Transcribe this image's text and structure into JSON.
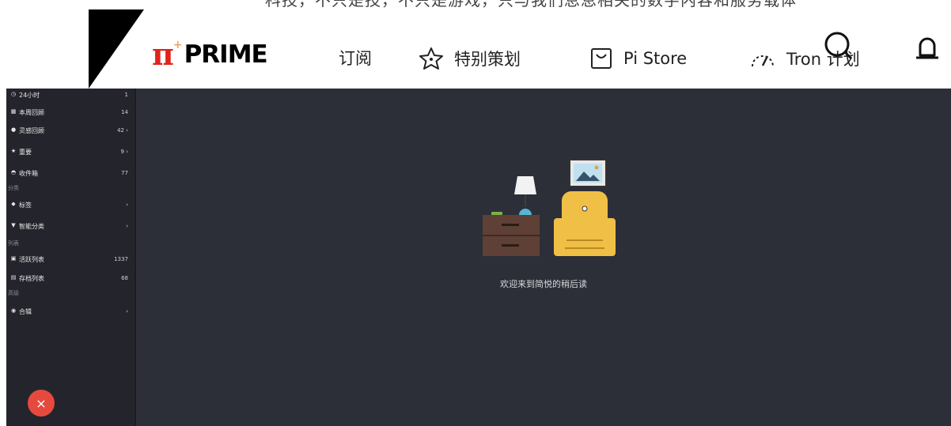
{
  "header": {
    "top_strip_text": "科技，不只是技，不只是游戏，只与我们息息相关的数字内容和服务载体",
    "logo": {
      "pi": "π",
      "plus": "+",
      "text": "PRIME"
    },
    "nav": [
      {
        "label": "订阅",
        "icon": "subscribe-icon"
      },
      {
        "label": "特别策划",
        "icon": "star-icon"
      },
      {
        "label": "Pi Store",
        "icon": "shopping-bag-icon"
      },
      {
        "label": "Tron 计划",
        "icon": "speedometer-icon"
      }
    ],
    "icons": [
      "search-icon",
      "bell-icon"
    ]
  },
  "sidebar": {
    "items": [
      {
        "icon": "clock-icon",
        "glyph": "◷",
        "label": "24小时",
        "count": "1"
      },
      {
        "icon": "calendar-icon",
        "glyph": "▦",
        "label": "本周回顾",
        "count": "14"
      },
      {
        "icon": "bulb-icon",
        "glyph": "●",
        "label": "灵感回顾",
        "count": "42 ›"
      },
      {
        "icon": "star-icon",
        "glyph": "★",
        "label": "重要",
        "count": "9 ›"
      },
      {
        "icon": "inbox-icon",
        "glyph": "◓",
        "label": "收件箱",
        "count": "77"
      }
    ],
    "section_category": "分类",
    "category_items": [
      {
        "icon": "tag-icon",
        "glyph": "◆",
        "label": "标签",
        "count": "›"
      },
      {
        "icon": "filter-icon",
        "glyph": "▼",
        "label": "智能分类",
        "count": "›"
      }
    ],
    "section_list": "列表",
    "list_items": [
      {
        "icon": "active-list-icon",
        "glyph": "▣",
        "label": "活跃列表",
        "count": "1337"
      },
      {
        "icon": "archive-icon",
        "glyph": "▤",
        "label": "存档列表",
        "count": "68"
      }
    ],
    "section_advanced": "高级",
    "advanced_items": [
      {
        "icon": "collection-icon",
        "glyph": "◉",
        "label": "合辑",
        "count": "›"
      }
    ],
    "close_glyph": "×"
  },
  "main": {
    "welcome_text": "欢迎来到简悦的稍后读"
  },
  "colors": {
    "app_bg": "#2d2f38",
    "sidebar_bg": "#24252c",
    "fab": "#e64a3e",
    "logo_red": "#e2231a",
    "chair": "#f0bf45",
    "cabinet": "#5e4036"
  }
}
